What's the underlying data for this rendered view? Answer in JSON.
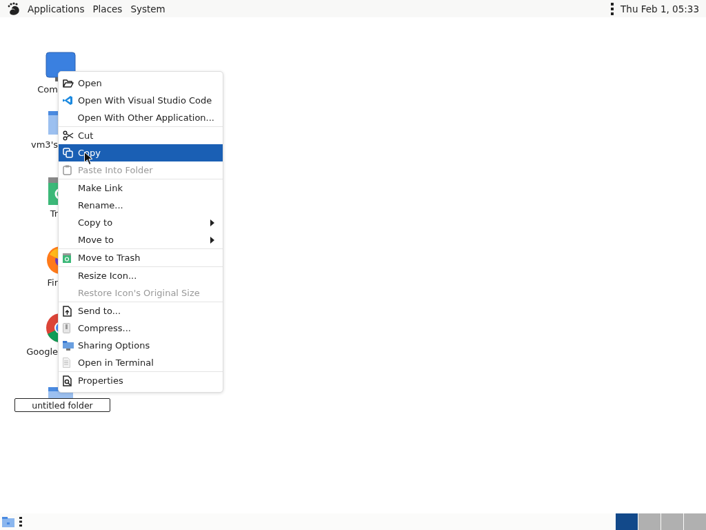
{
  "top_panel": {
    "menus": [
      {
        "label": "Applications"
      },
      {
        "label": "Places"
      },
      {
        "label": "System"
      }
    ],
    "clock": "Thu Feb  1, 05:33"
  },
  "desktop_icons": [
    {
      "label": "Com"
    },
    {
      "label": "vm3's"
    },
    {
      "label": "Tr"
    },
    {
      "label": "Fir"
    },
    {
      "label": "Google"
    }
  ],
  "rename_field": {
    "value": "untitled folder"
  },
  "context_menu": {
    "sections": [
      [
        {
          "label": "Open",
          "disabled": false,
          "selected": false,
          "submenu": false
        },
        {
          "label": "Open With Visual Studio Code",
          "disabled": false,
          "selected": false,
          "submenu": false
        },
        {
          "label": "Open With Other Application...",
          "disabled": false,
          "selected": false,
          "submenu": false
        }
      ],
      [
        {
          "label": "Cut",
          "disabled": false,
          "selected": false,
          "submenu": false
        },
        {
          "label": "Copy",
          "disabled": false,
          "selected": true,
          "submenu": false
        },
        {
          "label": "Paste Into Folder",
          "disabled": true,
          "selected": false,
          "submenu": false
        }
      ],
      [
        {
          "label": "Make Link",
          "disabled": false,
          "selected": false,
          "submenu": false
        },
        {
          "label": "Rename...",
          "disabled": false,
          "selected": false,
          "submenu": false
        },
        {
          "label": "Copy to",
          "disabled": false,
          "selected": false,
          "submenu": true
        },
        {
          "label": "Move to",
          "disabled": false,
          "selected": false,
          "submenu": true
        }
      ],
      [
        {
          "label": "Move to Trash",
          "disabled": false,
          "selected": false,
          "submenu": false
        }
      ],
      [
        {
          "label": "Resize Icon...",
          "disabled": false,
          "selected": false,
          "submenu": false
        },
        {
          "label": "Restore Icon's Original Size",
          "disabled": true,
          "selected": false,
          "submenu": false
        }
      ],
      [
        {
          "label": "Send to...",
          "disabled": false,
          "selected": false,
          "submenu": false
        },
        {
          "label": "Compress...",
          "disabled": false,
          "selected": false,
          "submenu": false
        },
        {
          "label": "Sharing Options",
          "disabled": false,
          "selected": false,
          "submenu": false
        },
        {
          "label": "Open in Terminal",
          "disabled": false,
          "selected": false,
          "submenu": false
        }
      ],
      [
        {
          "label": "Properties",
          "disabled": false,
          "selected": false,
          "submenu": false
        }
      ]
    ]
  },
  "bottom_panel": {
    "workspaces": [
      {
        "selected": true
      },
      {
        "selected": false
      },
      {
        "selected": false
      },
      {
        "selected": false
      }
    ]
  }
}
